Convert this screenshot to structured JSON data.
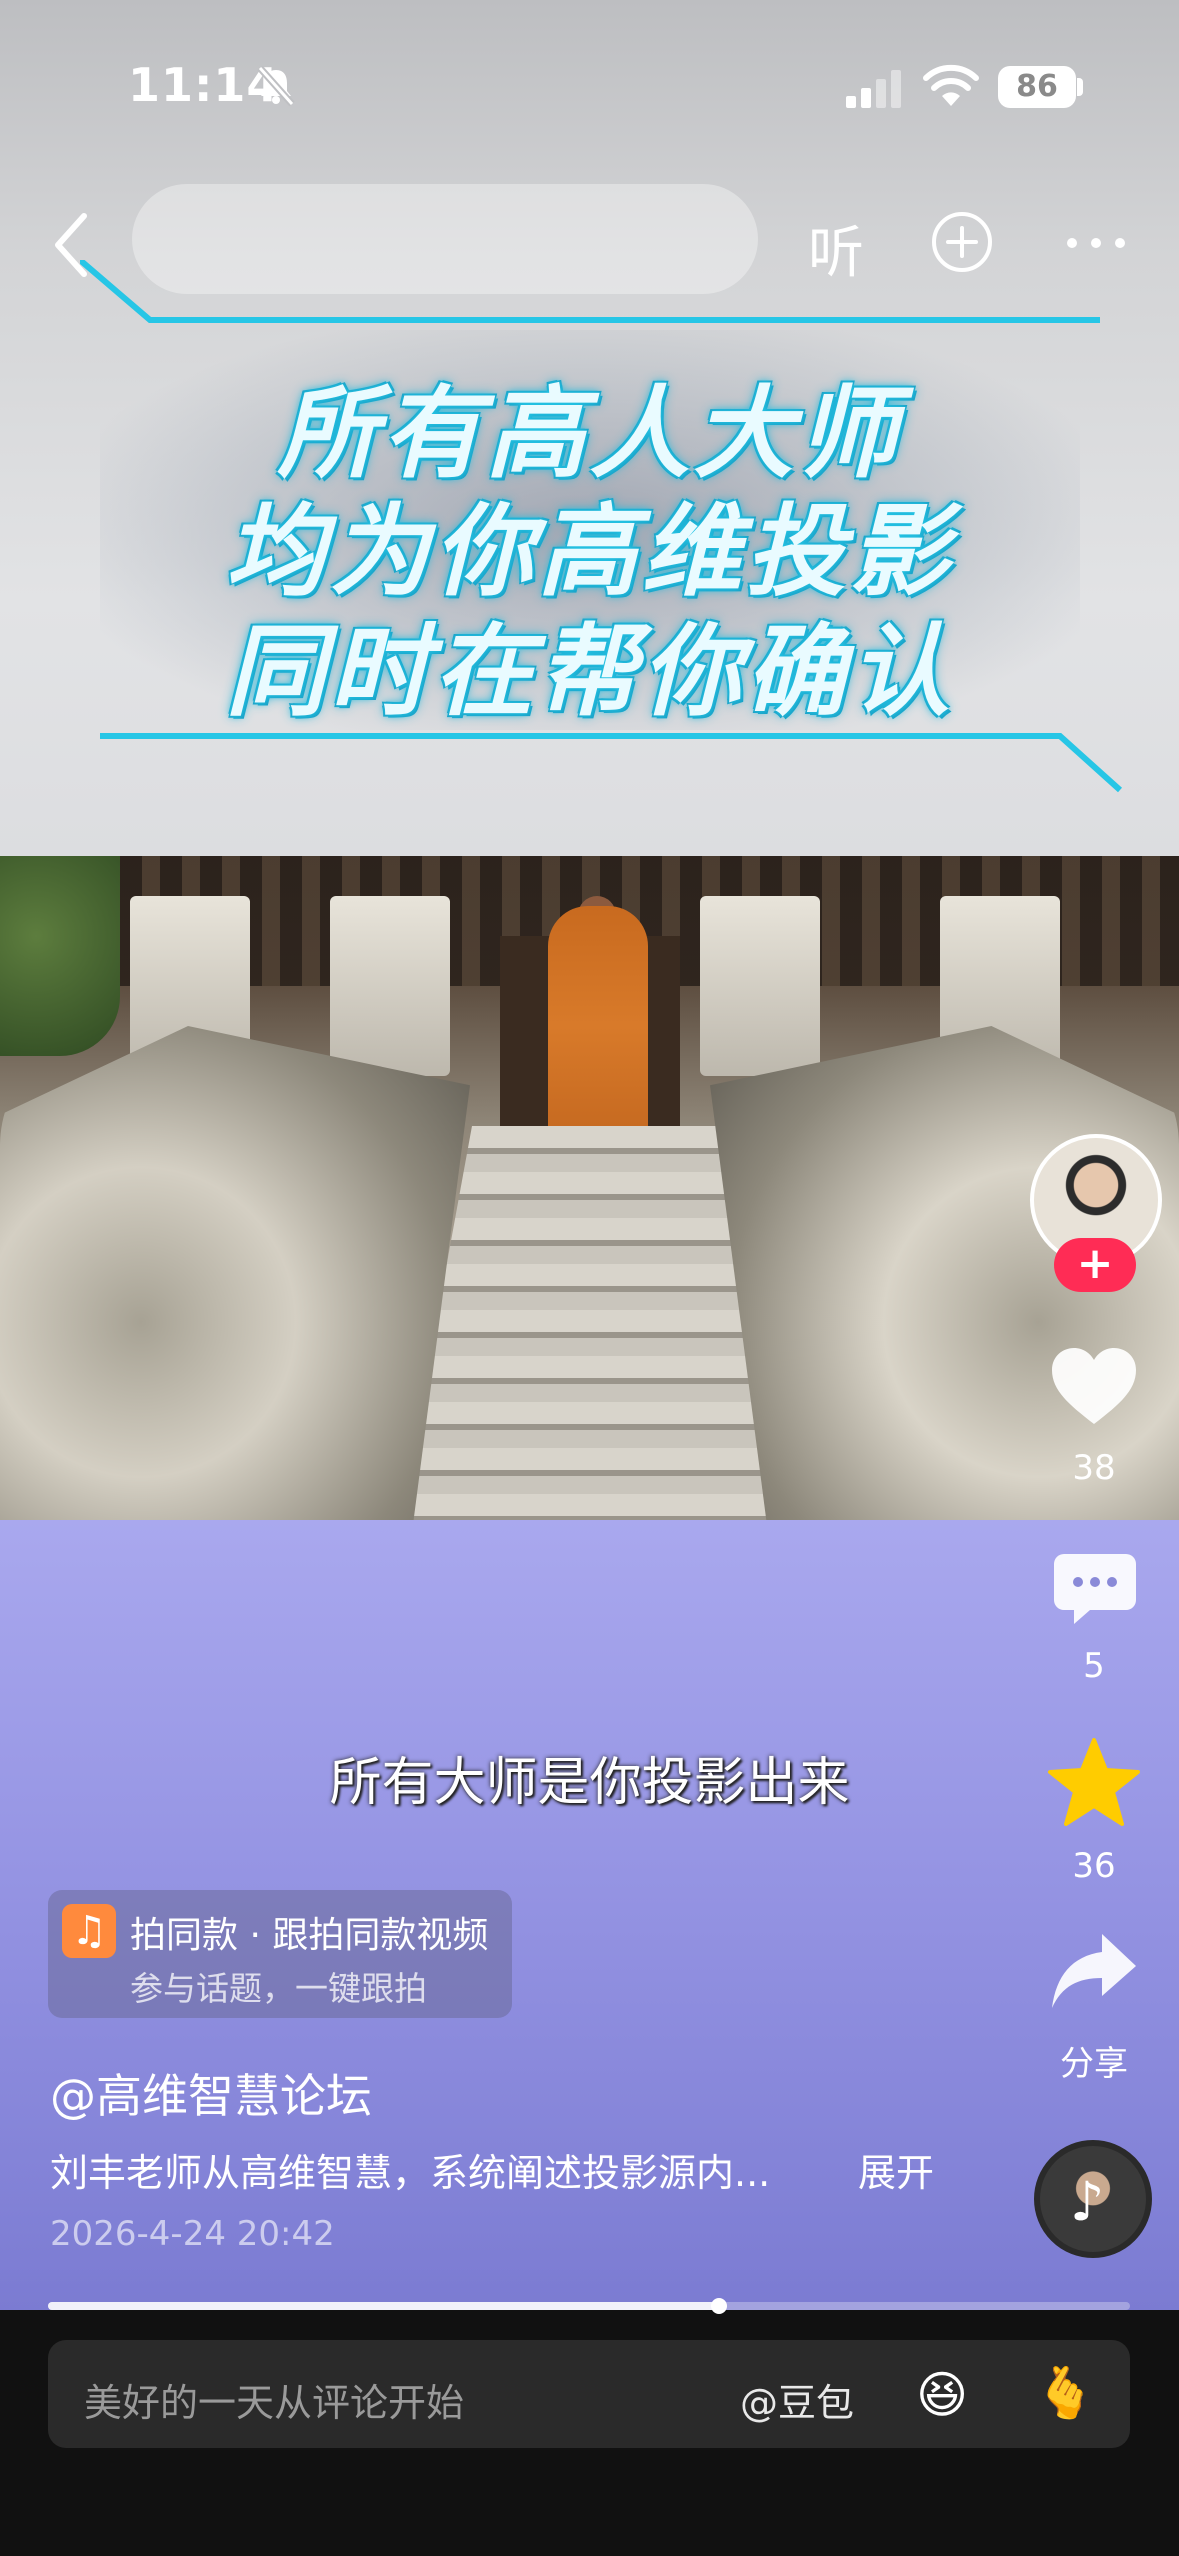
{
  "status_bar": {
    "time": "11:14",
    "battery": "86"
  },
  "nav": {
    "listen_label": "听"
  },
  "banner": {
    "lines": [
      "所有高人大师",
      "均为你高维投影",
      "同时在帮你确认"
    ]
  },
  "video": {
    "subtitle": "所有大师是你投影出来",
    "progress": 0.62
  },
  "actions": {
    "likes": "38",
    "comments": "5",
    "favorites": "36",
    "share_label": "分享"
  },
  "template": {
    "title": "拍同款 · 跟拍同款视频",
    "subtitle": "参与话题，一键跟拍",
    "icon": "♫"
  },
  "post": {
    "author": "@高维智慧论坛",
    "description": "刘丰老师从高维智慧，系统阐述投影源内...",
    "expand_label": "展开",
    "date": "2026-4-24 20:42"
  },
  "comment_bar": {
    "placeholder": "美好的一天从评论开始",
    "mention": "@豆包",
    "emoji1": "😆",
    "emoji2": "🫰"
  },
  "colors": {
    "follow_red": "#ff2c55",
    "favorite_yellow": "#ffcc00",
    "banner_cyan": "#27c6e6",
    "purple": "#9594e3"
  }
}
